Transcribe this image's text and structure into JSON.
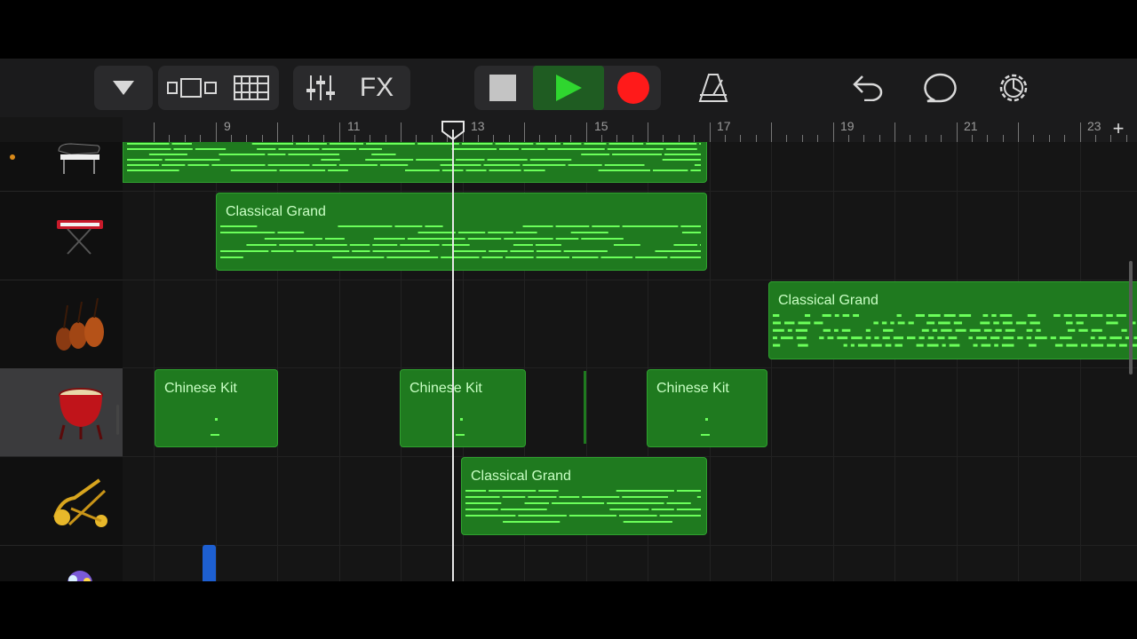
{
  "toolbar": {
    "fx_label": "FX",
    "icons": [
      "tracks-dropdown-icon",
      "browser-icon",
      "tracks-view-icon",
      "mixer-icon",
      "fx",
      "stop-icon",
      "play-icon",
      "record-icon",
      "metronome-icon",
      "undo-icon",
      "loop-icon",
      "settings-icon"
    ]
  },
  "ruler": {
    "bar_numbers": [
      "9",
      "11",
      "13",
      "15",
      "17",
      "19",
      "21",
      "23"
    ]
  },
  "tracks": [
    {
      "instrument": "grand-piano",
      "regions": []
    },
    {
      "instrument": "keyboard-synth",
      "regions": [
        "Classical Grand"
      ]
    },
    {
      "instrument": "strings",
      "regions": [
        "Classical Grand"
      ]
    },
    {
      "instrument": "chinese-drum",
      "regions": [
        "Chinese Kit",
        "Chinese Kit",
        "Chinese Kit"
      ]
    },
    {
      "instrument": "brass",
      "regions": [
        "Classical Grand"
      ]
    }
  ],
  "regions": {
    "classical_grand": "Classical Grand",
    "chinese_kit": "Chinese Kit"
  },
  "colors": {
    "region_fill": "#1f7a1f",
    "region_note": "#6bff5a",
    "record": "#ff1a1a",
    "play": "#2fd62f"
  }
}
